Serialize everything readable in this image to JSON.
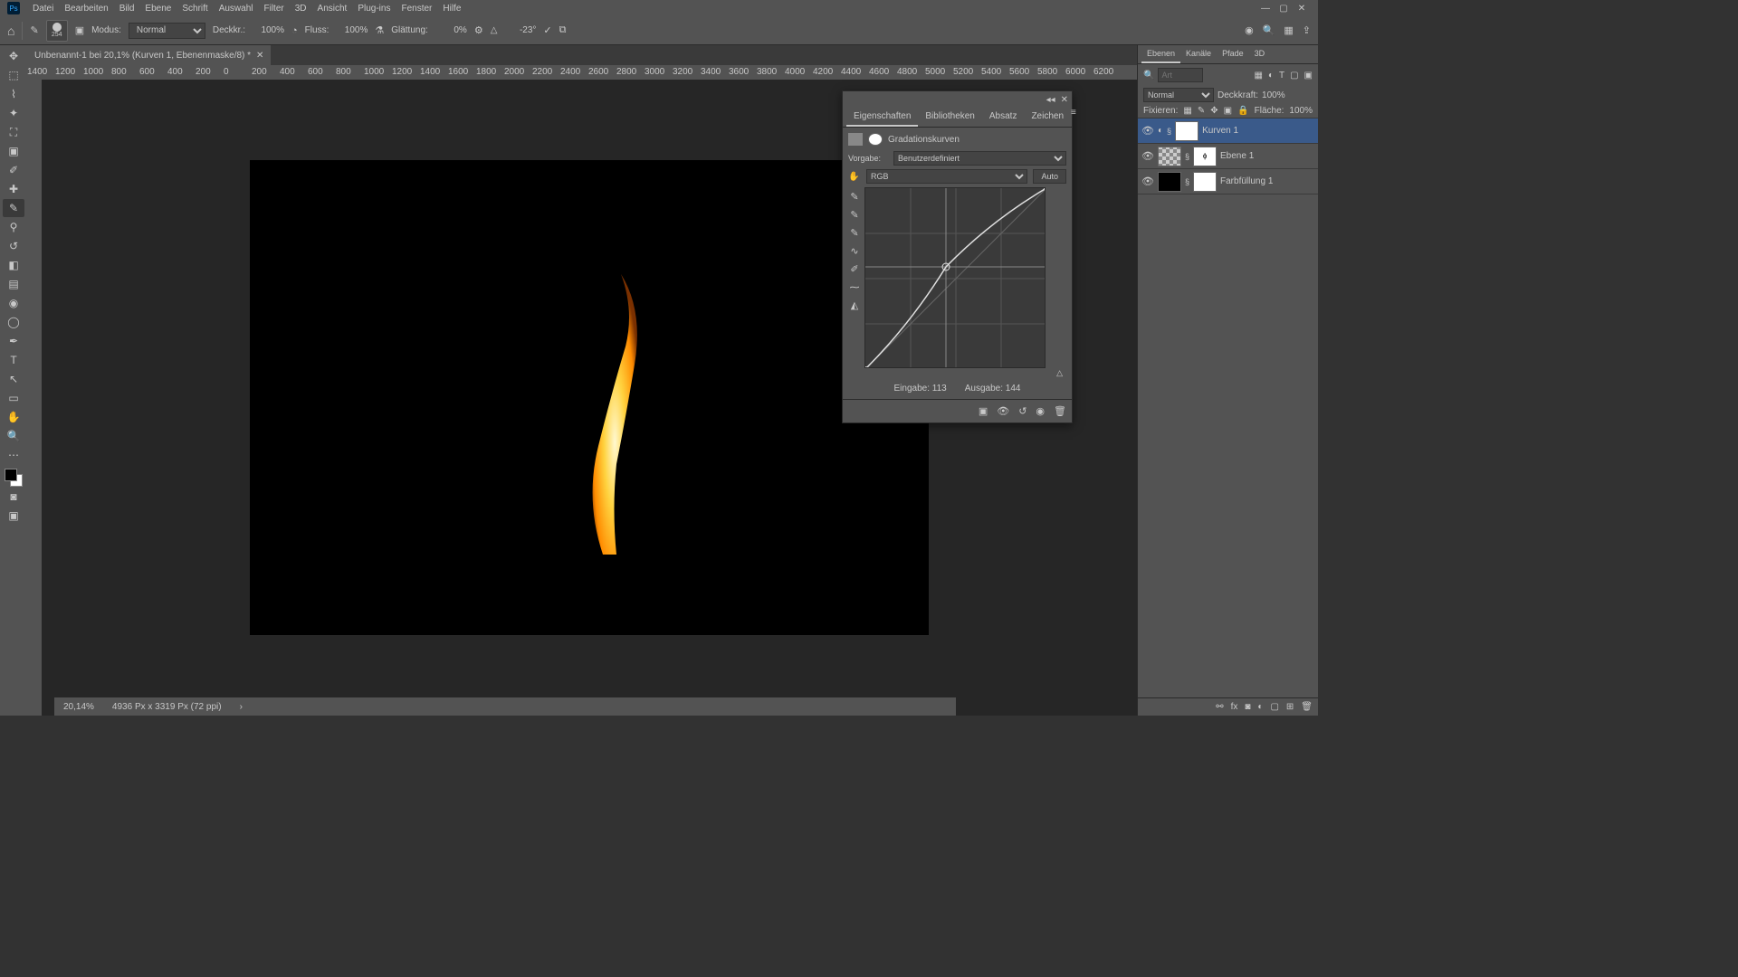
{
  "menu": {
    "items": [
      "Datei",
      "Bearbeiten",
      "Bild",
      "Ebene",
      "Schrift",
      "Auswahl",
      "Filter",
      "3D",
      "Ansicht",
      "Plug-ins",
      "Fenster",
      "Hilfe"
    ]
  },
  "opt": {
    "brush_size": "254",
    "mode_label": "Modus:",
    "mode_value": "Normal",
    "opacity_label": "Deckkr.:",
    "opacity_value": "100%",
    "flow_label": "Fluss:",
    "flow_value": "100%",
    "smooth_label": "Glättung:",
    "smooth_value": "0%",
    "angle_label": "△",
    "angle_value": "-23°"
  },
  "doc": {
    "tab_title": "Unbenannt-1 bei 20,1% (Kurven 1, Ebenenmaske/8) *",
    "zoom": "20,14%",
    "info": "4936 Px x 3319 Px (72 ppi)"
  },
  "ruler_ticks": [
    "1400",
    "1200",
    "1000",
    "800",
    "600",
    "400",
    "200",
    "0",
    "200",
    "400",
    "600",
    "800",
    "1000",
    "1200",
    "1400",
    "1600",
    "1800",
    "2000",
    "2200",
    "2400",
    "2600",
    "2800",
    "3000",
    "3200",
    "3400",
    "3600",
    "3800",
    "4000",
    "4200",
    "4400",
    "4600",
    "4800",
    "5000",
    "5200",
    "5400",
    "5600",
    "5800",
    "6000",
    "6200"
  ],
  "props": {
    "tabs": [
      "Eigenschaften",
      "Bibliotheken",
      "Absatz",
      "Zeichen"
    ],
    "adj_name": "Gradationskurven",
    "preset_label": "Vorgabe:",
    "preset_value": "Benutzerdefiniert",
    "channel": "RGB",
    "auto": "Auto",
    "input_label": "Eingabe:",
    "input_value": "113",
    "output_label": "Ausgabe:",
    "output_value": "144"
  },
  "rpanel": {
    "tabs": [
      "Ebenen",
      "Kanäle",
      "Pfade",
      "3D"
    ],
    "search_placeholder": "Art",
    "blend_mode": "Normal",
    "opacity_label": "Deckkraft:",
    "opacity_value": "100%",
    "lock_label": "Fixieren:",
    "fill_label": "Fläche:",
    "fill_value": "100%",
    "layers": [
      {
        "name": "Kurven 1"
      },
      {
        "name": "Ebene 1"
      },
      {
        "name": "Farbfüllung 1"
      }
    ]
  },
  "chart_data": {
    "type": "line",
    "title": "Gradationskurven (RGB)",
    "xlabel": "Eingabe",
    "ylabel": "Ausgabe",
    "xlim": [
      0,
      255
    ],
    "ylim": [
      0,
      255
    ],
    "points": [
      {
        "x": 0,
        "y": 0
      },
      {
        "x": 113,
        "y": 144
      },
      {
        "x": 255,
        "y": 255
      }
    ]
  }
}
